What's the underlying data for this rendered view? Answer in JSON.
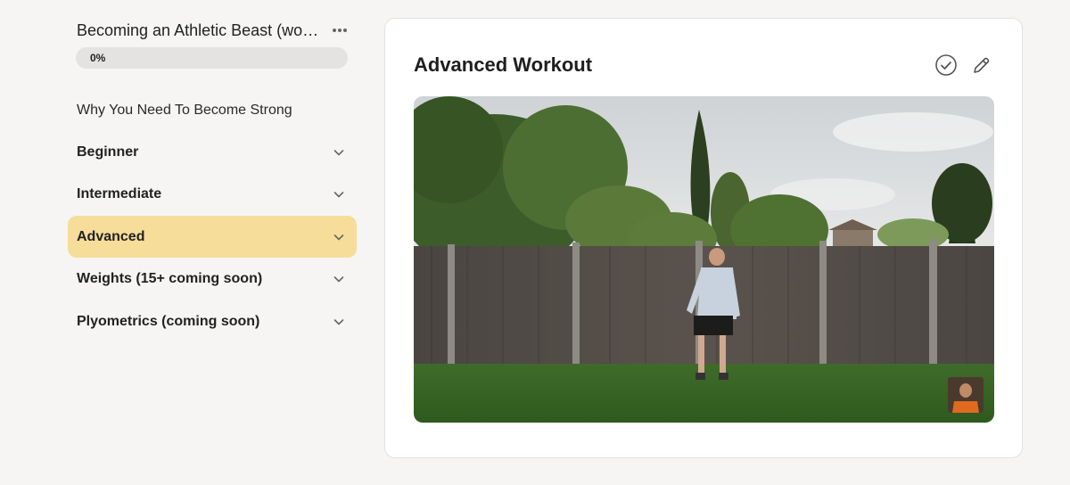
{
  "sidebar": {
    "course_title": "Becoming an Athletic Beast (workout programme)",
    "progress": {
      "label": "0%",
      "value": 0
    },
    "items": [
      {
        "label": "Why You Need To Become Strong",
        "expandable": false,
        "active": false
      },
      {
        "label": "Beginner",
        "expandable": true,
        "active": false
      },
      {
        "label": "Intermediate",
        "expandable": true,
        "active": false
      },
      {
        "label": "Advanced",
        "expandable": true,
        "active": true
      },
      {
        "label": "Weights (15+ coming soon)",
        "expandable": true,
        "active": false
      },
      {
        "label": "Plyometrics (coming soon)",
        "expandable": true,
        "active": false
      }
    ]
  },
  "main": {
    "title": "Advanced Workout",
    "actions": [
      {
        "icon": "check-circle-icon"
      },
      {
        "icon": "pencil-icon"
      }
    ]
  },
  "colors": {
    "active_item": "#f6dd99",
    "background": "#f6f5f3",
    "card": "#ffffff"
  }
}
